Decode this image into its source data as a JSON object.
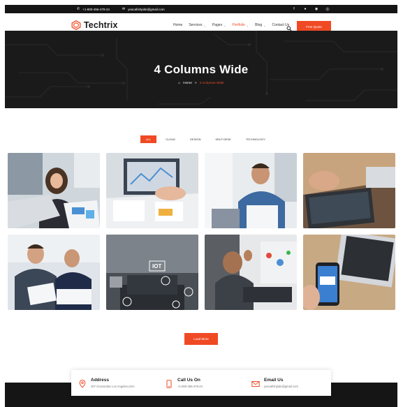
{
  "topbar": {
    "phone": "+1-800-456-478-24",
    "email": "yeacafishpide@gmail.com",
    "social_icons": [
      "facebook-icon",
      "github-icon",
      "instagram-icon",
      "skype-icon"
    ]
  },
  "header": {
    "brand": "Techtrix",
    "nav": [
      {
        "label": "Home",
        "has_dropdown": false,
        "active": false
      },
      {
        "label": "Services",
        "has_dropdown": true,
        "active": false
      },
      {
        "label": "Pages",
        "has_dropdown": true,
        "active": false
      },
      {
        "label": "Portfolio",
        "has_dropdown": true,
        "active": true
      },
      {
        "label": "Blog",
        "has_dropdown": true,
        "active": false
      },
      {
        "label": "Contact Us",
        "has_dropdown": false,
        "active": false
      }
    ],
    "cta": "Free Quote"
  },
  "hero": {
    "title": "4 Columns Wide",
    "breadcrumb_home": "Home",
    "breadcrumb_sep": ">",
    "breadcrumb_current": "4 Columns Wide"
  },
  "filters": [
    "ALL",
    "CLOUD",
    "DESIGN",
    "HELP DESK",
    "TECHNOLOGY"
  ],
  "active_filter": "ALL",
  "gallery": {
    "load_more": "Load More"
  },
  "contact": {
    "address_title": "Address",
    "address_value": "407 Gonzandar Los Angeles,USA",
    "call_title": "Call Us On",
    "call_value": "+1-800-456-478-24",
    "email_title": "Email Us",
    "email_value": "yeacafishpide@gmail.com"
  },
  "colors": {
    "accent": "#f04a24",
    "dark": "#151515"
  }
}
